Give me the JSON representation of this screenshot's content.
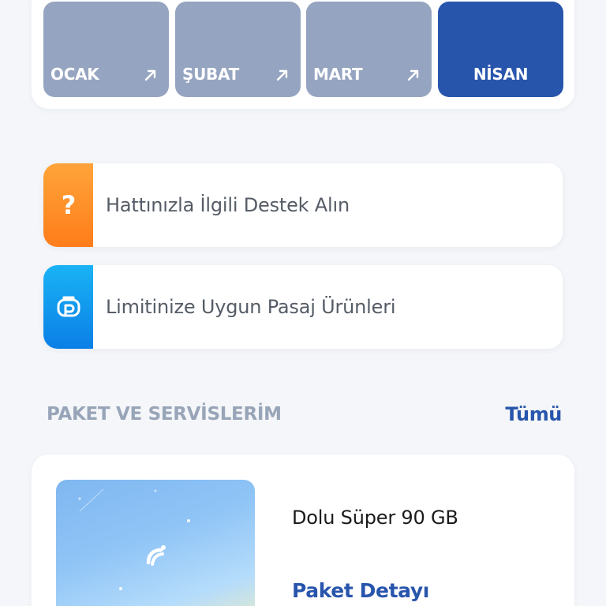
{
  "months": [
    {
      "label": "OCAK",
      "active": false
    },
    {
      "label": "ŞUBAT",
      "active": false
    },
    {
      "label": "MART",
      "active": false
    },
    {
      "label": "NİSAN",
      "active": true
    }
  ],
  "actions": [
    {
      "label": "Hattınızla İlgili Destek Alın",
      "icon": "question-icon",
      "color": "#ff8a1f"
    },
    {
      "label": "Limitinize Uygun Pasaj Ürünleri",
      "icon": "pasaj-icon",
      "color": "#0f8fec"
    }
  ],
  "section": {
    "title": "PAKET VE SERVİSLERİM",
    "see_all": "Tümü"
  },
  "package": {
    "name": "Dolu Süper 90 GB",
    "detail_link": "Paket Detayı",
    "logo_icon": "turkcell-logo-icon"
  },
  "colors": {
    "accent": "#2855ac",
    "inactive_tile": "#95a4c0",
    "background": "#f4f6f9"
  }
}
